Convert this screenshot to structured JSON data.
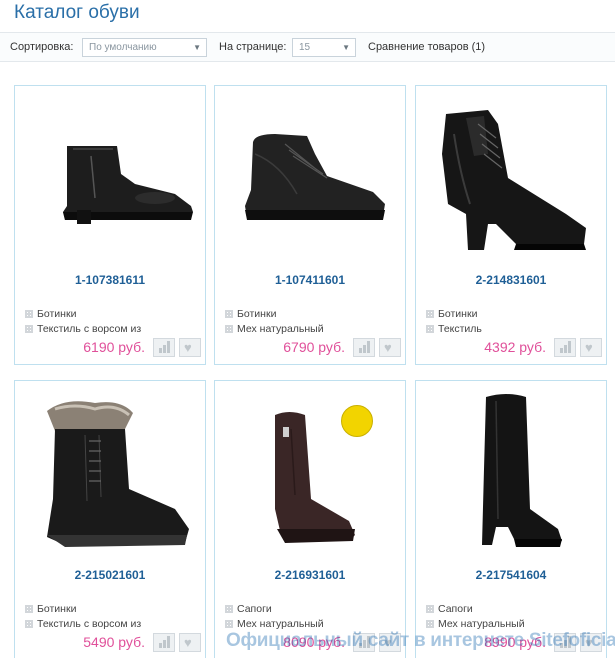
{
  "page": {
    "title": "Каталог обуви"
  },
  "toolbar": {
    "sort_label": "Сортировка:",
    "sort_value": "По умолчанию",
    "per_page_label": "На странице:",
    "per_page_value": "15",
    "compare_text": "Сравнение товаров (1)"
  },
  "products": [
    {
      "code": "1-107381611",
      "type": "Ботинки",
      "material": "Текстиль с ворсом из",
      "price": "6190 руб."
    },
    {
      "code": "1-107411601",
      "type": "Ботинки",
      "material": "Мех натуральный",
      "price": "6790 руб."
    },
    {
      "code": "2-214831601",
      "type": "Ботинки",
      "material": "Текстиль",
      "price": "4392 руб."
    },
    {
      "code": "2-215021601",
      "type": "Ботинки",
      "material": "Текстиль с ворсом из",
      "price": "5490 руб."
    },
    {
      "code": "2-216931601",
      "type": "Сапоги",
      "material": "Мех натуральный",
      "price": "8090 руб."
    },
    {
      "code": "2-217541604",
      "type": "Сапоги",
      "material": "Мех натуральный",
      "price": "8990 руб."
    }
  ],
  "icons": {
    "compare": "bar-chart-icon",
    "favorite": "heart-icon",
    "property": "grid-bullet-icon",
    "zipper": "zipper-badge-icon"
  },
  "colors": {
    "title": "#2a6fa8",
    "code": "#1f5f96",
    "price": "#e0509a",
    "card_border": "#bfe0ef"
  },
  "watermark": "Официальный сайт в интернете Sitefoficial.ru"
}
